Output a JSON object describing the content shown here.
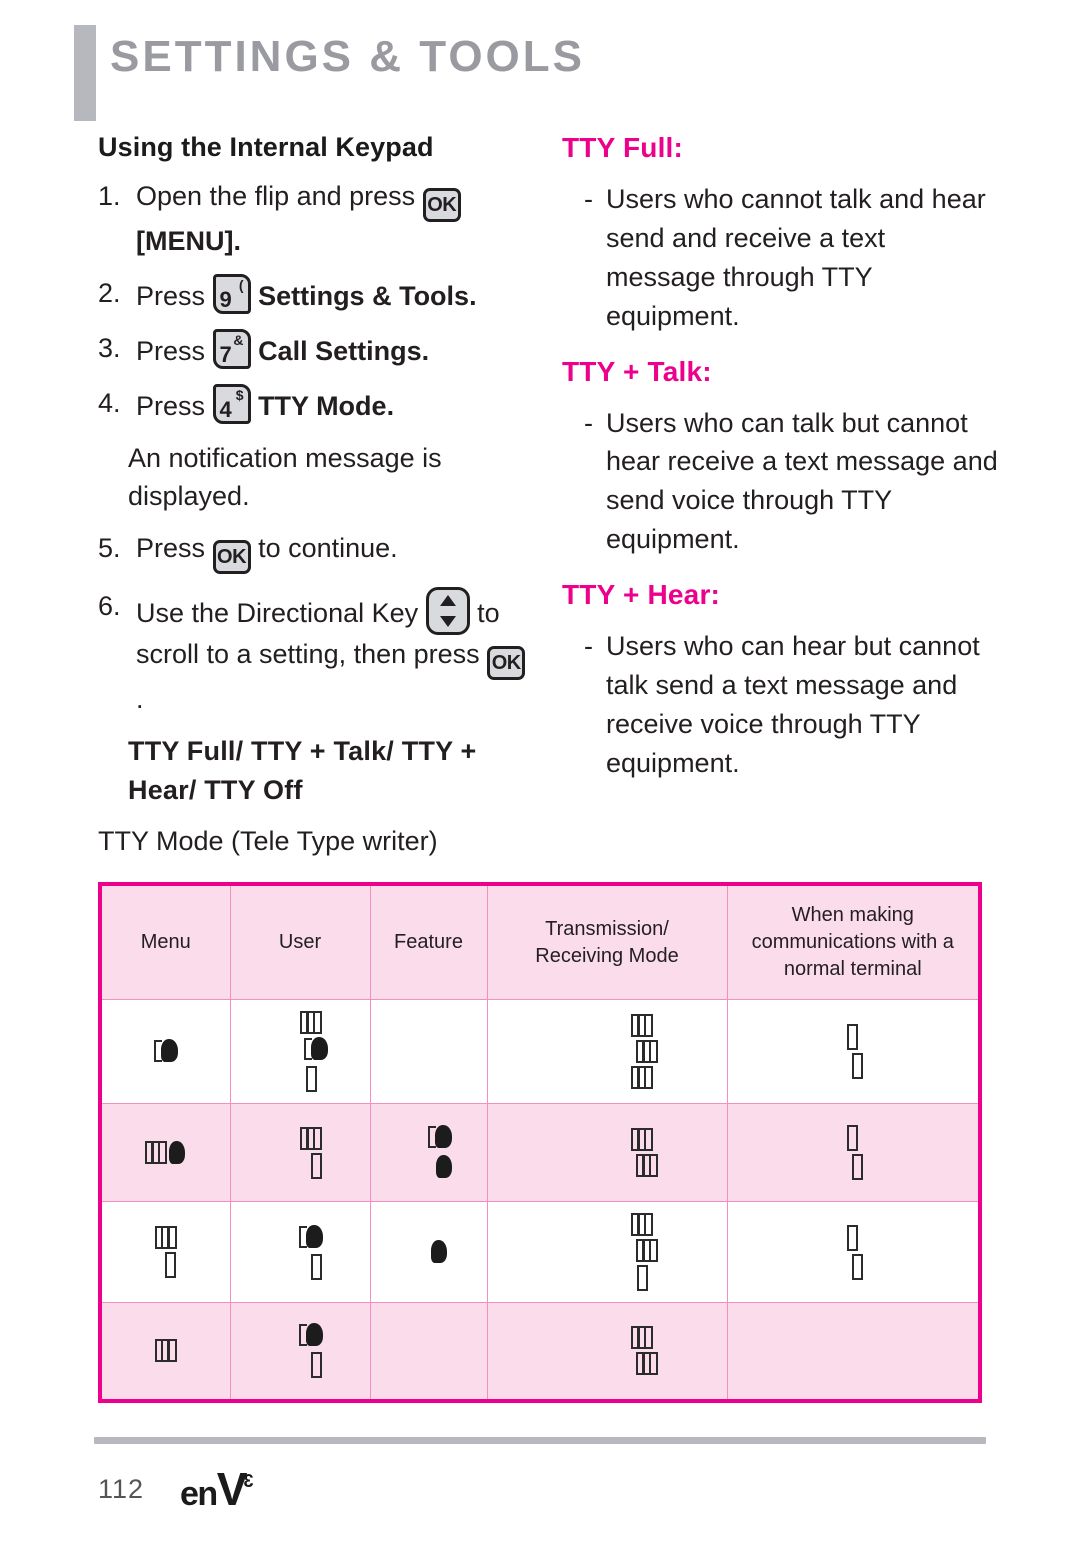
{
  "header": {
    "title": "SETTINGS & TOOLS",
    "accent_bar_color": "#b6b8bd",
    "title_color": "#9a9ba1"
  },
  "colors": {
    "pink_accent": "#ec008c",
    "pink_fill": "#fbdceb",
    "pink_grid": "#f48fc0",
    "gray_rule": "#b6b8bd",
    "body_text": "#231f20",
    "key_fill": "#d9dadd"
  },
  "left_column": {
    "subheading": "Using the Internal Keypad",
    "steps": [
      {
        "number": "1.",
        "text_before": "Open the flip and press",
        "key": {
          "type": "ok-key",
          "label": "OK"
        },
        "text_after_bold": "[MENU]."
      },
      {
        "number": "2.",
        "text_before": "Press",
        "key": {
          "type": "num-key",
          "digit": "9",
          "symbol": "("
        },
        "text_after_bold": "Settings & Tools."
      },
      {
        "number": "3.",
        "text_before": "Press",
        "key": {
          "type": "num-key",
          "digit": "7",
          "symbol": "&"
        },
        "text_after_bold": "Call Settings."
      },
      {
        "number": "4.",
        "text_before": "Press",
        "key": {
          "type": "num-key",
          "digit": "4",
          "symbol": "$"
        },
        "text_after_bold": "TTY Mode."
      }
    ],
    "note": "An notification message is displayed.",
    "step5": {
      "number": "5.",
      "text_before": "Press",
      "key": {
        "type": "ok-key",
        "label": "OK"
      },
      "text_after": "to continue."
    },
    "step6": {
      "number": "6.",
      "text_before": "Use the Directional Key",
      "dir_key": {
        "type": "directional-key",
        "up": "▲",
        "down": "▼"
      },
      "text_middle": "to scroll to a setting, then press",
      "key": {
        "type": "ok-key",
        "label": "OK"
      },
      "text_after": "."
    },
    "options_bold": "TTY Full/ TTY + Talk/ TTY + Hear/ TTY Off",
    "tty_mode_caption": "TTY Mode (Tele Type writer)"
  },
  "right_column": {
    "sections": [
      {
        "heading": "TTY Full:",
        "bullet_dash": "-",
        "bullet_text": "Users who cannot  talk and hear send and receive a text message through TTY equipment."
      },
      {
        "heading": "TTY + Talk:",
        "bullet_dash": "-",
        "bullet_text": "Users who can talk but cannot hear receive a text message and send voice through TTY equipment."
      },
      {
        "heading": "TTY + Hear:",
        "bullet_dash": "-",
        "bullet_text": "Users who can hear but cannot talk send a text message and receive voice through TTY equipment."
      }
    ]
  },
  "table": {
    "columns": [
      "Menu",
      "User",
      "Feature",
      "Transmission/\nReceiving Mode",
      "When making communications with a normal terminal"
    ],
    "column_headers_display": {
      "c0": "Menu",
      "c1": "User",
      "c2": "Feature",
      "c3_line1": "Transmission/",
      "c3_line2": "Receiving Mode",
      "c4_line1": "When making",
      "c4_line2": "communications with a",
      "c4_line3": "normal terminal"
    },
    "note": "All body cells render as missing-glyph (tofu) placeholder boxes in the source image; no legible characters are present.",
    "rows": [
      {
        "shade": "white",
        "cells": [
          {
            "glyphs": [
              [
                "blob"
              ]
            ]
          },
          {
            "glyphs": [
              [
                "wide"
              ],
              [
                "blob"
              ],
              [
                "narrow"
              ]
            ]
          },
          {
            "glyphs": []
          },
          {
            "glyphs": [
              [
                "wide"
              ],
              [
                "wide"
              ],
              [
                "wide"
              ]
            ]
          },
          {
            "glyphs": [
              [
                "narrow"
              ],
              [
                "narrow"
              ]
            ]
          }
        ]
      },
      {
        "shade": "pink",
        "cells": [
          {
            "glyphs": [
              [
                "wide",
                "blob2"
              ]
            ]
          },
          {
            "glyphs": [
              [
                "wide"
              ],
              [
                "narrow"
              ]
            ]
          },
          {
            "glyphs": [
              [
                "blob"
              ],
              [
                "blob2"
              ]
            ]
          },
          {
            "glyphs": [
              [
                "wide"
              ],
              [
                "wide"
              ]
            ]
          },
          {
            "glyphs": [
              [
                "narrow"
              ],
              [
                "narrow"
              ]
            ]
          }
        ]
      },
      {
        "shade": "white",
        "cells": [
          {
            "glyphs": [
              [
                "wide"
              ],
              [
                "narrow"
              ]
            ]
          },
          {
            "glyphs": [
              [
                "blob"
              ],
              [
                "narrow"
              ]
            ]
          },
          {
            "glyphs": [
              [
                "blob2"
              ]
            ]
          },
          {
            "glyphs": [
              [
                "wide"
              ],
              [
                "wide"
              ],
              [
                "narrow"
              ]
            ]
          },
          {
            "glyphs": [
              [
                "narrow"
              ],
              [
                "narrow"
              ]
            ]
          }
        ]
      },
      {
        "shade": "pink",
        "cells": [
          {
            "glyphs": [
              [
                "wide"
              ]
            ]
          },
          {
            "glyphs": [
              [
                "blob"
              ],
              [
                "narrow"
              ]
            ]
          },
          {
            "glyphs": []
          },
          {
            "glyphs": [
              [
                "wide"
              ],
              [
                "wide"
              ]
            ]
          },
          {
            "glyphs": []
          }
        ]
      }
    ]
  },
  "footer": {
    "page_number": "112",
    "brand_en": "en",
    "brand_v": "V",
    "brand_sup": "3"
  }
}
